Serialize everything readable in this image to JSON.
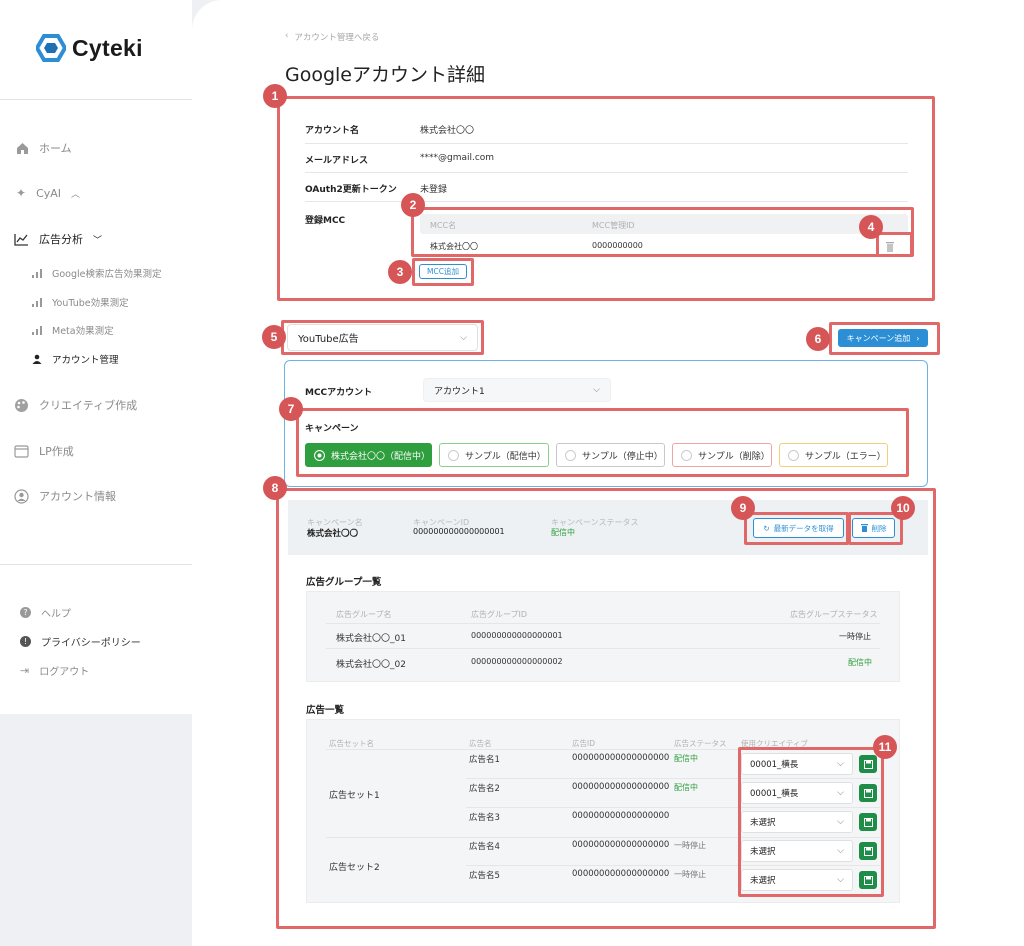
{
  "sidebar": {
    "brand": "Cyteki",
    "nav": {
      "home": "ホーム",
      "cyai": "CyAI",
      "ad_analysis": "広告分析",
      "creative": "クリエイティブ作成",
      "lp": "LP作成",
      "account_info": "アカウント情報"
    },
    "sub": {
      "google": "Google検索広告効果測定",
      "youtube": "YouTube効果測定",
      "meta": "Meta効果測定",
      "account": "アカウント管理"
    },
    "footer": {
      "help": "ヘルプ",
      "privacy": "プライバシーポリシー",
      "logout": "ログアウト"
    }
  },
  "header": {
    "back": "アカウント管理へ戻る",
    "title": "Googleアカウント詳細"
  },
  "account": {
    "name_label": "アカウント名",
    "name": "株式会社〇〇",
    "email_label": "メールアドレス",
    "email": "****@gmail.com",
    "oauth_label": "OAuth2更新トークン",
    "oauth": "未登録",
    "mcc_label": "登録MCC",
    "mcc_cols": [
      "MCC名",
      "MCC管理ID"
    ],
    "mcc_row": {
      "name": "株式会社〇〇",
      "id": "0000000000"
    },
    "add_mcc": "MCC追加"
  },
  "platform": {
    "selected": "YouTube広告",
    "add_campaign": "キャンペーン追加"
  },
  "panel": {
    "mcc_label": "MCCアカウント",
    "mcc_value": "アカウント1",
    "campaign_label": "キャンペーン",
    "campaigns": [
      "株式会社〇〇（配信中）",
      "サンプル（配信中）",
      "サンプル（停止中）",
      "サンプル（削除）",
      "サンプル（エラー）"
    ]
  },
  "summary": {
    "name_label": "キャンペーン名",
    "name": "株式会社〇〇",
    "id_label": "キャンペーンID",
    "id": "000000000000000001",
    "status_label": "キャンペーンステータス",
    "status": "配信中",
    "fetch": "最新データを取得",
    "delete": "削除"
  },
  "adgroups": {
    "title": "広告グループ一覧",
    "cols": [
      "広告グループ名",
      "広告グループID",
      "広告グループステータス"
    ],
    "rows": [
      {
        "name": "株式会社〇〇_01",
        "id": "000000000000000001",
        "status": "一時停止"
      },
      {
        "name": "株式会社〇〇_02",
        "id": "000000000000000002",
        "status": "配信中"
      }
    ]
  },
  "ads": {
    "title": "広告一覧",
    "cols": [
      "広告セット名",
      "広告名",
      "広告ID",
      "広告ステータス",
      "使用クリエイティブ"
    ],
    "sets": [
      "広告セット1",
      "広告セット2"
    ],
    "rows": [
      {
        "name": "広告名1",
        "id": "000000000000000000",
        "status": "配信中",
        "creative": "00001_横長"
      },
      {
        "name": "広告名2",
        "id": "000000000000000000",
        "status": "配信中",
        "creative": "00001_横長"
      },
      {
        "name": "広告名3",
        "id": "000000000000000000",
        "status": "",
        "creative": "未選択"
      },
      {
        "name": "広告名4",
        "id": "000000000000000000",
        "status": "一時停止",
        "creative": "未選択"
      },
      {
        "name": "広告名5",
        "id": "000000000000000000",
        "status": "一時停止",
        "creative": "未選択"
      }
    ]
  },
  "markers": [
    "1",
    "2",
    "3",
    "4",
    "5",
    "6",
    "7",
    "8",
    "9",
    "10",
    "11"
  ],
  "colors": {
    "accent": "#2c8fd6",
    "marker": "#d65556",
    "active": "#2e9e3e"
  }
}
